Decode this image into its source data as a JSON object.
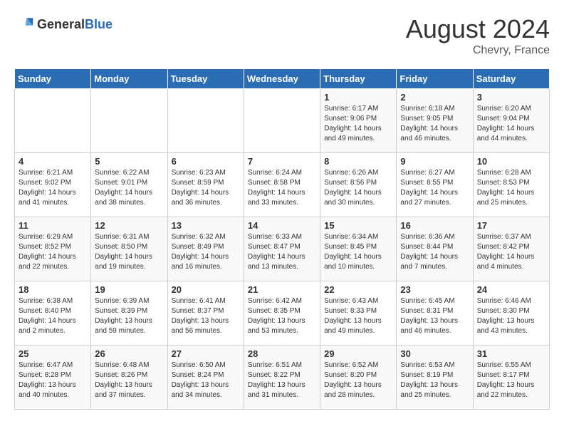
{
  "header": {
    "logo_general": "General",
    "logo_blue": "Blue",
    "month_year": "August 2024",
    "location": "Chevry, France"
  },
  "weekdays": [
    "Sunday",
    "Monday",
    "Tuesday",
    "Wednesday",
    "Thursday",
    "Friday",
    "Saturday"
  ],
  "weeks": [
    [
      {
        "day": "",
        "info": ""
      },
      {
        "day": "",
        "info": ""
      },
      {
        "day": "",
        "info": ""
      },
      {
        "day": "",
        "info": ""
      },
      {
        "day": "1",
        "info": "Sunrise: 6:17 AM\nSunset: 9:06 PM\nDaylight: 14 hours\nand 49 minutes."
      },
      {
        "day": "2",
        "info": "Sunrise: 6:18 AM\nSunset: 9:05 PM\nDaylight: 14 hours\nand 46 minutes."
      },
      {
        "day": "3",
        "info": "Sunrise: 6:20 AM\nSunset: 9:04 PM\nDaylight: 14 hours\nand 44 minutes."
      }
    ],
    [
      {
        "day": "4",
        "info": "Sunrise: 6:21 AM\nSunset: 9:02 PM\nDaylight: 14 hours\nand 41 minutes."
      },
      {
        "day": "5",
        "info": "Sunrise: 6:22 AM\nSunset: 9:01 PM\nDaylight: 14 hours\nand 38 minutes."
      },
      {
        "day": "6",
        "info": "Sunrise: 6:23 AM\nSunset: 8:59 PM\nDaylight: 14 hours\nand 36 minutes."
      },
      {
        "day": "7",
        "info": "Sunrise: 6:24 AM\nSunset: 8:58 PM\nDaylight: 14 hours\nand 33 minutes."
      },
      {
        "day": "8",
        "info": "Sunrise: 6:26 AM\nSunset: 8:56 PM\nDaylight: 14 hours\nand 30 minutes."
      },
      {
        "day": "9",
        "info": "Sunrise: 6:27 AM\nSunset: 8:55 PM\nDaylight: 14 hours\nand 27 minutes."
      },
      {
        "day": "10",
        "info": "Sunrise: 6:28 AM\nSunset: 8:53 PM\nDaylight: 14 hours\nand 25 minutes."
      }
    ],
    [
      {
        "day": "11",
        "info": "Sunrise: 6:29 AM\nSunset: 8:52 PM\nDaylight: 14 hours\nand 22 minutes."
      },
      {
        "day": "12",
        "info": "Sunrise: 6:31 AM\nSunset: 8:50 PM\nDaylight: 14 hours\nand 19 minutes."
      },
      {
        "day": "13",
        "info": "Sunrise: 6:32 AM\nSunset: 8:49 PM\nDaylight: 14 hours\nand 16 minutes."
      },
      {
        "day": "14",
        "info": "Sunrise: 6:33 AM\nSunset: 8:47 PM\nDaylight: 14 hours\nand 13 minutes."
      },
      {
        "day": "15",
        "info": "Sunrise: 6:34 AM\nSunset: 8:45 PM\nDaylight: 14 hours\nand 10 minutes."
      },
      {
        "day": "16",
        "info": "Sunrise: 6:36 AM\nSunset: 8:44 PM\nDaylight: 14 hours\nand 7 minutes."
      },
      {
        "day": "17",
        "info": "Sunrise: 6:37 AM\nSunset: 8:42 PM\nDaylight: 14 hours\nand 4 minutes."
      }
    ],
    [
      {
        "day": "18",
        "info": "Sunrise: 6:38 AM\nSunset: 8:40 PM\nDaylight: 14 hours\nand 2 minutes."
      },
      {
        "day": "19",
        "info": "Sunrise: 6:39 AM\nSunset: 8:39 PM\nDaylight: 13 hours\nand 59 minutes."
      },
      {
        "day": "20",
        "info": "Sunrise: 6:41 AM\nSunset: 8:37 PM\nDaylight: 13 hours\nand 56 minutes."
      },
      {
        "day": "21",
        "info": "Sunrise: 6:42 AM\nSunset: 8:35 PM\nDaylight: 13 hours\nand 53 minutes."
      },
      {
        "day": "22",
        "info": "Sunrise: 6:43 AM\nSunset: 8:33 PM\nDaylight: 13 hours\nand 49 minutes."
      },
      {
        "day": "23",
        "info": "Sunrise: 6:45 AM\nSunset: 8:31 PM\nDaylight: 13 hours\nand 46 minutes."
      },
      {
        "day": "24",
        "info": "Sunrise: 6:46 AM\nSunset: 8:30 PM\nDaylight: 13 hours\nand 43 minutes."
      }
    ],
    [
      {
        "day": "25",
        "info": "Sunrise: 6:47 AM\nSunset: 8:28 PM\nDaylight: 13 hours\nand 40 minutes."
      },
      {
        "day": "26",
        "info": "Sunrise: 6:48 AM\nSunset: 8:26 PM\nDaylight: 13 hours\nand 37 minutes."
      },
      {
        "day": "27",
        "info": "Sunrise: 6:50 AM\nSunset: 8:24 PM\nDaylight: 13 hours\nand 34 minutes."
      },
      {
        "day": "28",
        "info": "Sunrise: 6:51 AM\nSunset: 8:22 PM\nDaylight: 13 hours\nand 31 minutes."
      },
      {
        "day": "29",
        "info": "Sunrise: 6:52 AM\nSunset: 8:20 PM\nDaylight: 13 hours\nand 28 minutes."
      },
      {
        "day": "30",
        "info": "Sunrise: 6:53 AM\nSunset: 8:19 PM\nDaylight: 13 hours\nand 25 minutes."
      },
      {
        "day": "31",
        "info": "Sunrise: 6:55 AM\nSunset: 8:17 PM\nDaylight: 13 hours\nand 22 minutes."
      }
    ]
  ]
}
